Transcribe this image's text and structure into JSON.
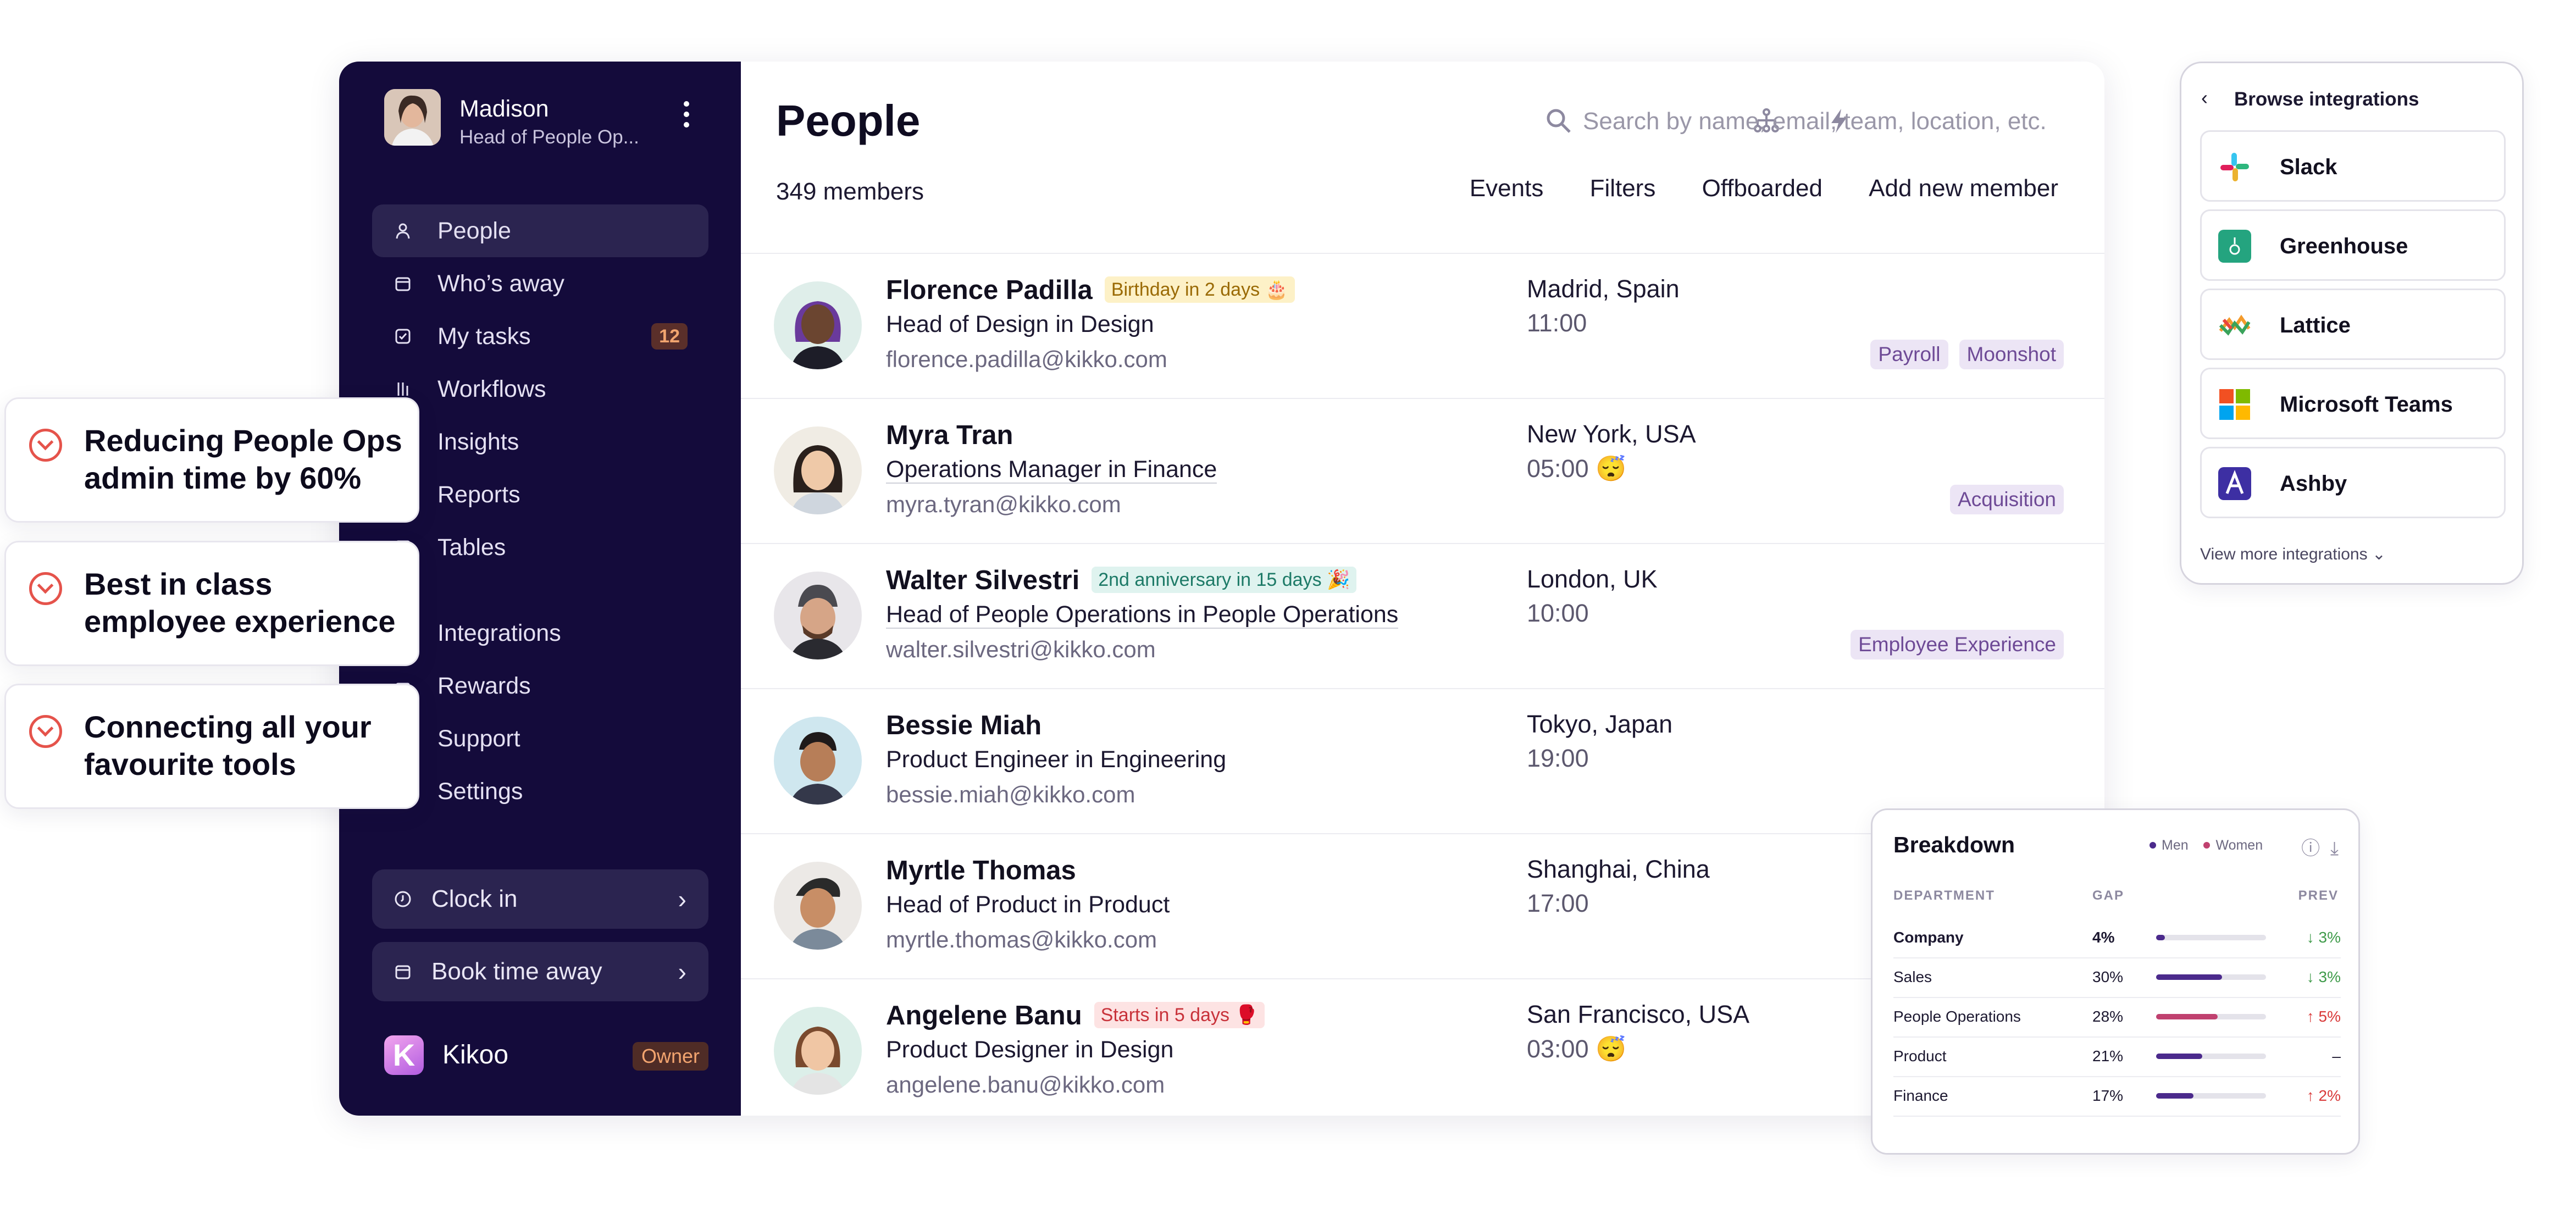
{
  "profile": {
    "name": "Madison",
    "role": "Head of People Op..."
  },
  "nav": [
    {
      "label": "People",
      "icon": "person-icon",
      "active": true
    },
    {
      "label": "Who’s away",
      "icon": "calendar-icon"
    },
    {
      "label": "My tasks",
      "icon": "checkbox-icon",
      "badge": "12"
    },
    {
      "label": "Workflows",
      "icon": "workflow-icon"
    },
    {
      "label": "Insights",
      "icon": "chart-icon"
    },
    {
      "label": "Reports",
      "icon": "report-icon"
    },
    {
      "label": "Tables",
      "icon": "table-icon"
    },
    {
      "label": "Integrations",
      "icon": "plug-icon"
    },
    {
      "label": "Rewards",
      "icon": "gift-icon"
    },
    {
      "label": "Support",
      "icon": "help-icon"
    },
    {
      "label": "Settings",
      "icon": "gear-icon"
    }
  ],
  "sidebar_actions": {
    "clock_in": "Clock in",
    "book_time_away": "Book time away"
  },
  "brand": {
    "name": "Kikoo",
    "logo_letter": "K",
    "role_badge": "Owner"
  },
  "page": {
    "title": "People",
    "members": "349 members",
    "search_placeholder": "Search by name, email, team, location, etc.",
    "actions": [
      "Events",
      "Filters",
      "Offboarded",
      "Add new member"
    ]
  },
  "people": [
    {
      "name": "Florence Padilla",
      "tag": "Birthday in 2 days 🎂",
      "tag_color": "#fdf1c7",
      "tag_text": "#9a6a05",
      "role": "Head of Design in Design",
      "email": "florence.padilla@kikko.com",
      "location": "Madrid, Spain",
      "time": "11:00",
      "teams": [
        "Payroll",
        "Moonshot"
      ]
    },
    {
      "name": "Myra Tran",
      "tag": "",
      "role": "Operations Manager in Finance",
      "email": "myra.tyran@kikko.com",
      "location": "New York, USA",
      "time": "05:00 😴",
      "teams": [
        "Acquisition"
      ]
    },
    {
      "name": "Walter Silvestri",
      "tag": "2nd anniversary in 15 days 🎉",
      "tag_color": "#dff3ef",
      "tag_text": "#1d7a67",
      "role": "Head of People Operations in People Operations",
      "email": "walter.silvestri@kikko.com",
      "location": "London, UK",
      "time": "10:00",
      "teams": [
        "Employee Experience"
      ]
    },
    {
      "name": "Bessie Miah",
      "tag": "",
      "role": "Product Engineer in Engineering",
      "email": "bessie.miah@kikko.com",
      "location": "Tokyo, Japan",
      "time": "19:00",
      "teams": []
    },
    {
      "name": "Myrtle Thomas",
      "tag": "",
      "role": "Head of Product in Product",
      "email": "myrtle.thomas@kikko.com",
      "location": "Shanghai, China",
      "time": "17:00",
      "teams": []
    },
    {
      "name": "Angelene Banu",
      "tag": "Starts in 5 days 🥊",
      "tag_color": "#fde3e3",
      "tag_text": "#c8323a",
      "role": "Product Designer in Design",
      "email": "angelene.banu@kikko.com",
      "location": "San Francisco, USA",
      "time": "03:00 😴",
      "teams": []
    }
  ],
  "callouts": [
    "Reducing People Ops admin time by 60%",
    "Best in class employee experience",
    "Connecting all your favourite tools"
  ],
  "integrations": {
    "title": "Browse integrations",
    "items": [
      "Slack",
      "Greenhouse",
      "Lattice",
      "Microsoft Teams",
      "Ashby"
    ],
    "more": "View more integrations ⌄"
  },
  "breakdown": {
    "title": "Breakdown",
    "legend": [
      "Men",
      "Women"
    ],
    "colors": {
      "men": "#4b2a8c",
      "women": "#c0416f"
    },
    "headers": [
      "DEPARTMENT",
      "GAP",
      "PREV"
    ],
    "rows": [
      {
        "dept": "Company",
        "gap": "4%",
        "gap_value": 4,
        "prev": "↓ 3%",
        "prev_color": "#3f9b4a",
        "bar_color": "#4b2a8c",
        "bold": true
      },
      {
        "dept": "Sales",
        "gap": "30%",
        "gap_value": 30,
        "prev": "↓ 3%",
        "prev_color": "#3f9b4a",
        "bar_color": "#4b2a8c"
      },
      {
        "dept": "People Operations",
        "gap": "28%",
        "gap_value": 28,
        "prev": "↑ 5%",
        "prev_color": "#d93a3a",
        "bar_color": "#c0416f"
      },
      {
        "dept": "Product",
        "gap": "21%",
        "gap_value": 21,
        "prev": "–",
        "prev_color": "#1c1830",
        "bar_color": "#4b2a8c"
      },
      {
        "dept": "Finance",
        "gap": "17%",
        "gap_value": 17,
        "prev": "↑ 2%",
        "prev_color": "#d93a3a",
        "bar_color": "#4b2a8c"
      }
    ]
  }
}
